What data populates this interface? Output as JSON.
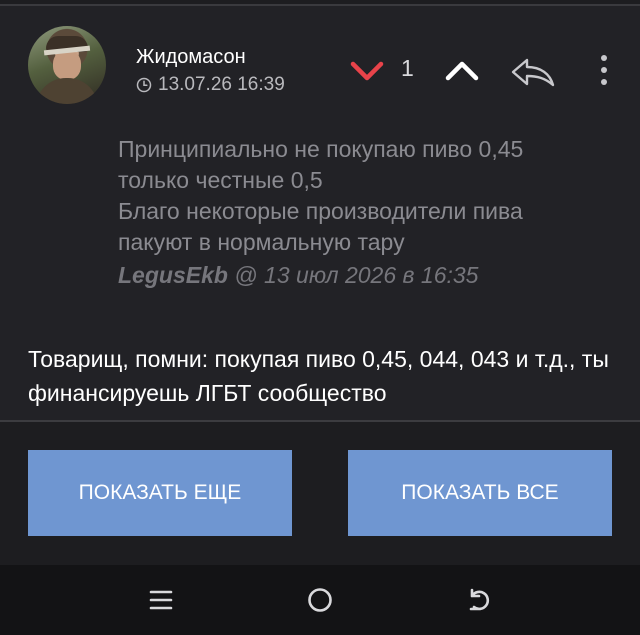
{
  "comment": {
    "author": "Жидомасон",
    "timestamp": "13.07.26 16:39",
    "score": "1",
    "quote": {
      "lines": [
        "Принципиально не покупаю пиво 0,45",
        "только честные 0,5",
        "Благо некоторые производители пива",
        "пакуют в нормальную тару"
      ],
      "author": "LegusEkb",
      "meta": " @ 13 июл 2026 в 16:35"
    },
    "text": "Товарищ, помни: покупая пиво 0,45, 044, 043 и т.д., ты финансируешь ЛГБТ сообщество"
  },
  "buttons": {
    "show_more": "ПОКАЗАТЬ ЕЩЕ",
    "show_all": "ПОКАЗАТЬ ВСЕ"
  },
  "icons": {
    "downvote": "chevron-down-icon",
    "upvote": "chevron-up-icon",
    "reply": "reply-arrow-icon",
    "more": "more-vertical-icon",
    "clock": "clock-icon",
    "nav_menu": "menu-icon",
    "nav_home": "home-circle-icon",
    "nav_back": "back-icon"
  },
  "colors": {
    "background": "#1d1d20",
    "comment_background": "#222226",
    "downvote_active": "#e8434a",
    "button": "#6f96d1",
    "quote_text": "#8b8b91",
    "navbar": "#131315"
  }
}
